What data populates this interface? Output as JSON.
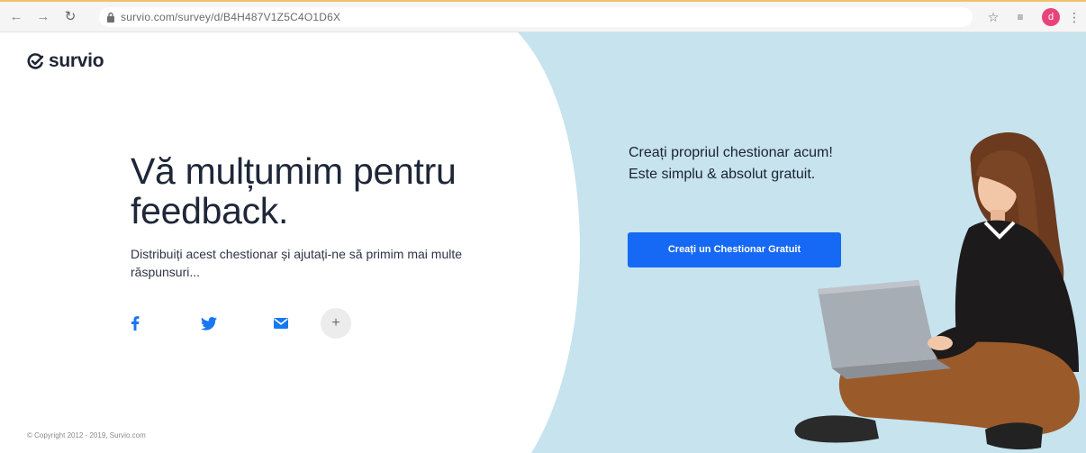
{
  "browser": {
    "url": "survio.com/survey/d/B4H487V1Z5C4O1D6X",
    "avatar_letter": "d"
  },
  "brand": {
    "logo_text": "survio"
  },
  "thankyou": {
    "title": "Vă mulțumim pentru feedback.",
    "subtitle": "Distribuiți acest chestionar și ajutați-ne să primim mai multe răspunsuri..."
  },
  "share": {
    "icons": [
      "facebook-icon",
      "twitter-icon",
      "email-icon",
      "plus-icon"
    ],
    "more_label": "+"
  },
  "footer": {
    "copyright": "© Copyright 2012 - 2019, Survio.com"
  },
  "promo": {
    "text": "Creați propriul chestionar acum! Este simplu & absolut gratuit.",
    "cta_label": "Creați un Chestionar Gratuit"
  },
  "colors": {
    "accent_blue": "#1669f5",
    "panel_blue": "#c6e3ee",
    "share_blue": "#1877f2",
    "avatar_pink": "#e8437a"
  }
}
